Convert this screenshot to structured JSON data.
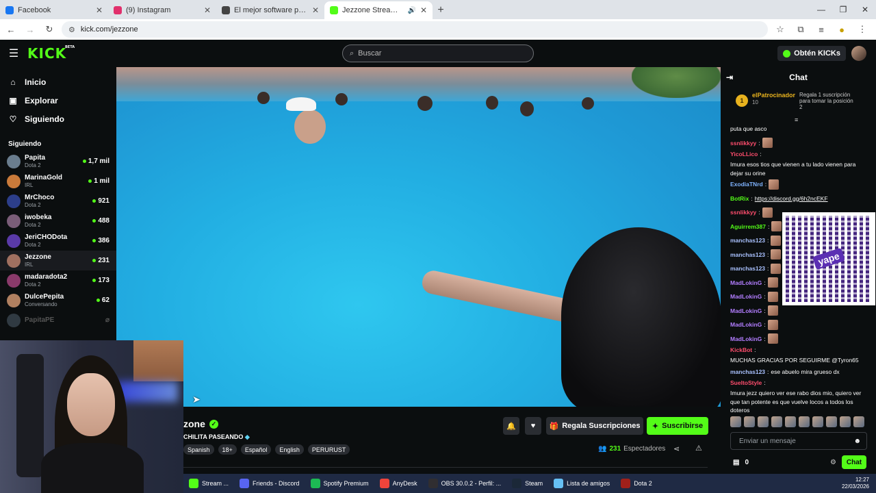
{
  "browser": {
    "tabs": [
      {
        "title": "Facebook",
        "color": "#1877f2"
      },
      {
        "title": "(9) Instagram",
        "color": "#e1306c"
      },
      {
        "title": "El mejor software para potencia",
        "color": "#444444"
      },
      {
        "title": "Jezzone Stream - Watch Liv",
        "color": "#53fc18"
      }
    ],
    "url": "kick.com/jezzone"
  },
  "header": {
    "logo": "KICK",
    "logo_sup": "BETA",
    "search_placeholder": "Buscar",
    "kicks_label": "Obtén KICKs"
  },
  "sidebar": {
    "nav": [
      {
        "label": "Inicio",
        "icon": "home-icon"
      },
      {
        "label": "Explorar",
        "icon": "compass-icon"
      },
      {
        "label": "Siguiendo",
        "icon": "heart-icon"
      }
    ],
    "section_title": "Siguiendo",
    "channels": [
      {
        "name": "Papita",
        "category": "Dota 2",
        "viewers": "1,7 mil",
        "color": "#6a7d8e"
      },
      {
        "name": "MarinaGold",
        "category": "IRL",
        "viewers": "1 mil",
        "color": "#c97a3a"
      },
      {
        "name": "MrChoco",
        "category": "Dota 2",
        "viewers": "921",
        "color": "#2c3e8a"
      },
      {
        "name": "iwobeka",
        "category": "Dota 2",
        "viewers": "488",
        "color": "#7a5d78"
      },
      {
        "name": "JeriCHODota",
        "category": "Dota 2",
        "viewers": "386",
        "color": "#5a3aa8"
      },
      {
        "name": "Jezzone",
        "category": "IRL",
        "viewers": "231",
        "color": "#a07060"
      },
      {
        "name": "madaradota2",
        "category": "Dota 2",
        "viewers": "173",
        "color": "#8a3a6a"
      },
      {
        "name": "DulcePepita",
        "category": "Conversando",
        "viewers": "62",
        "color": "#b08060"
      },
      {
        "name": "PapitaPE",
        "category": "",
        "viewers": "",
        "color": "#6a7d8e"
      }
    ]
  },
  "stream": {
    "name": "zone",
    "title": "CHILITA PASEANDO",
    "tags": [
      "Spanish",
      "18+",
      "Español",
      "English",
      "PERURUST"
    ],
    "gift_label": "Regala Suscripciones",
    "subscribe_label": "Suscribirse",
    "viewers_count": "231",
    "viewers_label": "Espectadores"
  },
  "chat": {
    "title": "Chat",
    "pinned": {
      "rank": "1",
      "user": "elPatrocinador",
      "count": "10",
      "text": "Regala 1 suscripción para tomar la posición 2"
    },
    "messages": [
      {
        "user": "",
        "user_color": "#ffffff",
        "text": "puta que asco",
        "emote": false,
        "link": false
      },
      {
        "user": "ssnlikkyy",
        "user_color": "#ff4d6d",
        "text": "",
        "emote": true,
        "link": false
      },
      {
        "user": "YicoLLico",
        "user_color": "#ff4d6d",
        "text": "Imura esos tios que vienen a tu lado vienen para dejar su orine",
        "emote": false,
        "link": false
      },
      {
        "user": "ExodiaTNrd",
        "user_color": "#7fb3ff",
        "text": "",
        "emote": true,
        "link": false
      },
      {
        "user": "BotRix",
        "user_color": "#53fc18",
        "text": "https://discord.gg/6h2ncEKF",
        "emote": false,
        "link": true
      },
      {
        "user": "ssnlikkyy",
        "user_color": "#ff4d6d",
        "text": "",
        "emote": true,
        "link": false
      },
      {
        "user": "Aguirrem387",
        "user_color": "#53fc18",
        "text": "",
        "emote": true,
        "link": false
      },
      {
        "user": "manchas123",
        "user_color": "#a9c1ff",
        "text": "",
        "emote": true,
        "link": false
      },
      {
        "user": "manchas123",
        "user_color": "#a9c1ff",
        "text": "",
        "emote": true,
        "link": false
      },
      {
        "user": "manchas123",
        "user_color": "#a9c1ff",
        "text": "",
        "emote": true,
        "link": false
      },
      {
        "user": "MadLokinG",
        "user_color": "#b27dff",
        "text": "",
        "emote": true,
        "link": false
      },
      {
        "user": "MadLokinG",
        "user_color": "#b27dff",
        "text": "",
        "emote": true,
        "link": false
      },
      {
        "user": "MadLokinG",
        "user_color": "#b27dff",
        "text": "",
        "emote": true,
        "link": false
      },
      {
        "user": "MadLokinG",
        "user_color": "#b27dff",
        "text": "",
        "emote": true,
        "link": false
      },
      {
        "user": "MadLokinG",
        "user_color": "#b27dff",
        "text": "",
        "emote": true,
        "link": false
      },
      {
        "user": "KickBot",
        "user_color": "#ff4d6d",
        "text": "MUCHAS GRACIAS POR SEGUIRME @Tyron65",
        "emote": false,
        "link": false
      },
      {
        "user": "manchas123",
        "user_color": "#a9c1ff",
        "text": "ese abuelo mira grueso dx",
        "emote": false,
        "link": false
      },
      {
        "user": "SueltoStyle",
        "user_color": "#ff4d6d",
        "text": "Imura jezz quiero ver ese rabo dios mio, quiero ver que tan potente es que vuelve locos a todos los doteros",
        "emote": false,
        "link": false
      }
    ],
    "qr_brand": "yape",
    "input_placeholder": "Enviar un mensaje",
    "points": "0",
    "chat_button": "Chat"
  },
  "taskbar": {
    "items": [
      {
        "label": "Stream ...",
        "color": "#53fc18"
      },
      {
        "label": "Friends - Discord",
        "color": "#5865f2"
      },
      {
        "label": "Spotify Premium",
        "color": "#1db954"
      },
      {
        "label": "AnyDesk",
        "color": "#ef443b"
      },
      {
        "label": "OBS 30.0.2 - Perfil: ...",
        "color": "#302e31"
      },
      {
        "label": "Steam",
        "color": "#1b2838"
      },
      {
        "label": "Lista de amigos",
        "color": "#66c0f4"
      },
      {
        "label": "Dota 2",
        "color": "#a0201a"
      }
    ],
    "time": "12:27",
    "date": "22/03/2026"
  }
}
